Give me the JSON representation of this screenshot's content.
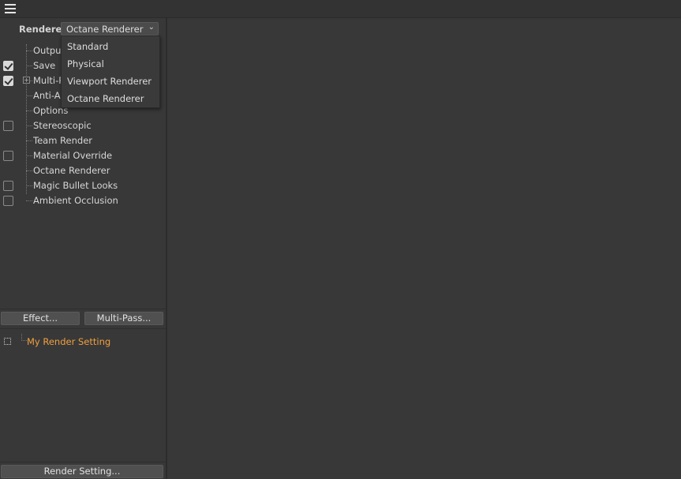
{
  "top_bar": {
    "menu_icon": "hamburger-menu-icon"
  },
  "renderer": {
    "label": "Renderer",
    "selected": "Octane Renderer",
    "options": [
      "Standard",
      "Physical",
      "Viewport Renderer",
      "Octane Renderer"
    ]
  },
  "tree": {
    "items": [
      {
        "label": "Output",
        "checkbox": false,
        "checked": false
      },
      {
        "label": "Save",
        "checkbox": true,
        "checked": true
      },
      {
        "label": "Multi-P",
        "checkbox": true,
        "checked": true,
        "expandable": true
      },
      {
        "label": "Anti-Al",
        "checkbox": false,
        "checked": false
      },
      {
        "label": "Options",
        "checkbox": false,
        "checked": false
      },
      {
        "label": "Stereoscopic",
        "checkbox": true,
        "checked": false
      },
      {
        "label": "Team Render",
        "checkbox": false,
        "checked": false
      },
      {
        "label": "Material Override",
        "checkbox": true,
        "checked": false
      },
      {
        "label": "Octane Renderer",
        "checkbox": false,
        "checked": false
      },
      {
        "label": "Magic Bullet Looks",
        "checkbox": true,
        "checked": false
      },
      {
        "label": "Ambient Occlusion",
        "checkbox": true,
        "checked": false
      }
    ]
  },
  "buttons": {
    "effect": "Effect...",
    "multi_pass": "Multi-Pass...",
    "render_setting": "Render Setting..."
  },
  "render_settings": {
    "item_label": "My Render Setting",
    "accent_color": "#f0a040"
  }
}
